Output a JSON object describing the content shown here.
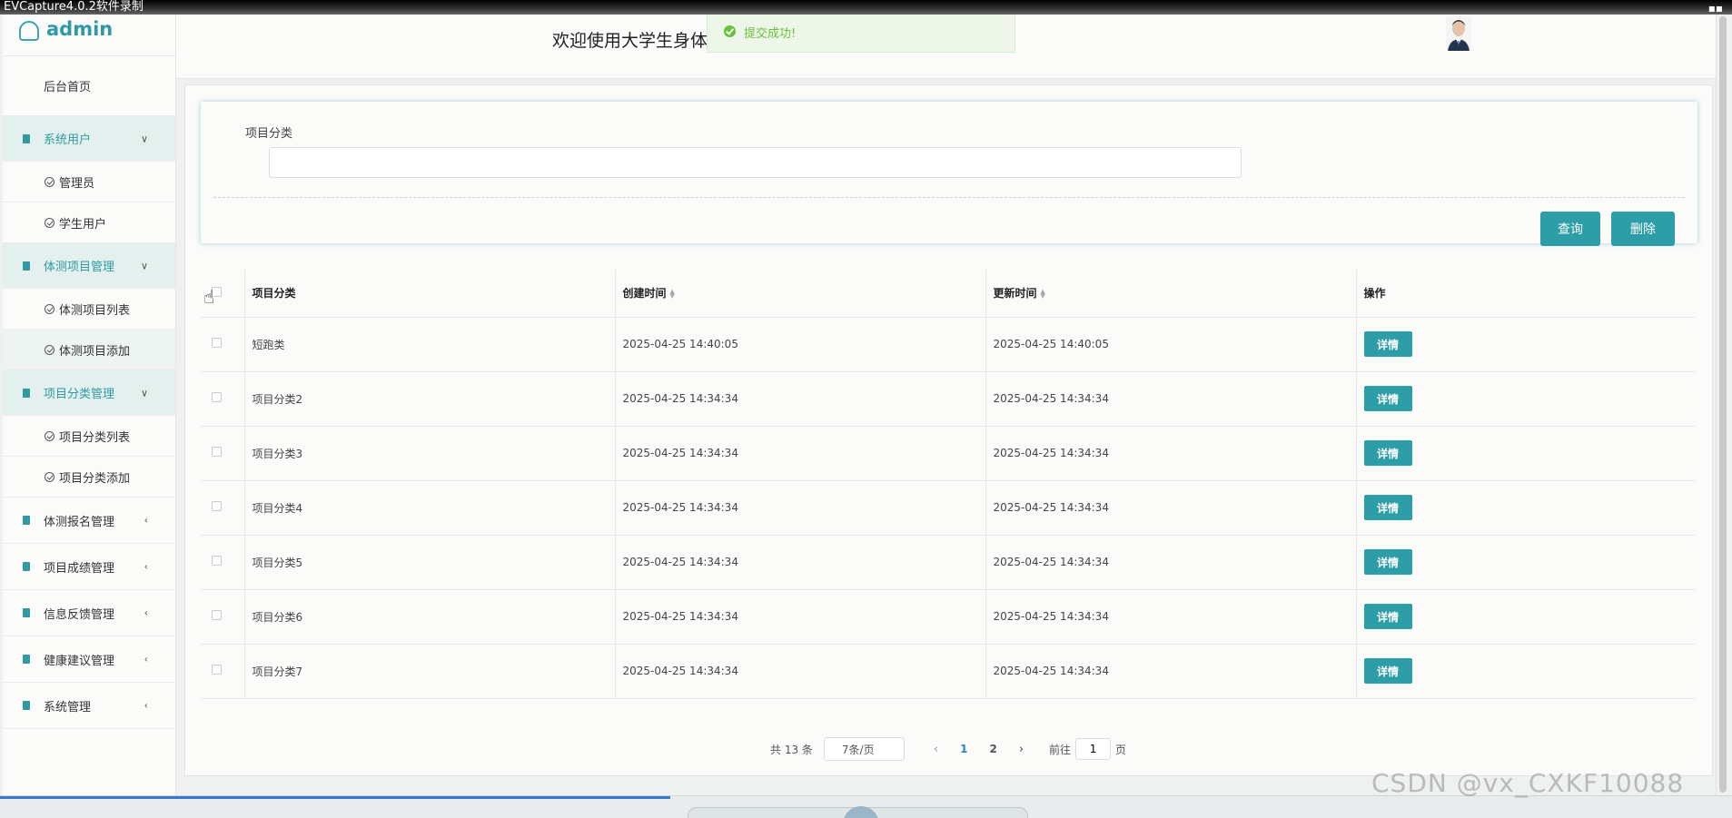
{
  "recorder": {
    "title": "EVCapture4.0.2软件录制",
    "corner_icon": "window-icon"
  },
  "sidebar": {
    "user": "admin",
    "home": "后台首页",
    "groups": [
      {
        "label": "系统用户",
        "items": [
          "管理员",
          "学生用户"
        ]
      },
      {
        "label": "体测项目管理",
        "items": [
          "体测项目列表",
          "体测项目添加"
        ]
      },
      {
        "label": "项目分类管理",
        "items": [
          "项目分类列表",
          "项目分类添加"
        ]
      }
    ],
    "closed": [
      "体测报名管理",
      "项目成绩管理",
      "信息反馈管理",
      "健康建议管理",
      "系统管理"
    ]
  },
  "header": {
    "welcome": "欢迎使用大学生身体",
    "toast": "提交成功!"
  },
  "search": {
    "label": "项目分类",
    "value": "",
    "query_button": "查询",
    "delete_button": "删除"
  },
  "table": {
    "headers": [
      "项目分类",
      "创建时间",
      "更新时间",
      "操作"
    ],
    "rows": [
      {
        "name": "短跑类",
        "created": "2025-04-25 14:40:05",
        "updated": "2025-04-25 14:40:05",
        "action": "详情"
      },
      {
        "name": "项目分类2",
        "created": "2025-04-25 14:34:34",
        "updated": "2025-04-25 14:34:34",
        "action": "详情"
      },
      {
        "name": "项目分类3",
        "created": "2025-04-25 14:34:34",
        "updated": "2025-04-25 14:34:34",
        "action": "详情"
      },
      {
        "name": "项目分类4",
        "created": "2025-04-25 14:34:34",
        "updated": "2025-04-25 14:34:34",
        "action": "详情"
      },
      {
        "name": "项目分类5",
        "created": "2025-04-25 14:34:34",
        "updated": "2025-04-25 14:34:34",
        "action": "详情"
      },
      {
        "name": "项目分类6",
        "created": "2025-04-25 14:34:34",
        "updated": "2025-04-25 14:34:34",
        "action": "详情"
      },
      {
        "name": "项目分类7",
        "created": "2025-04-25 14:34:34",
        "updated": "2025-04-25 14:34:34",
        "action": "详情"
      }
    ]
  },
  "pagination": {
    "total": "共 13 条",
    "page_size": "7条/页",
    "pages": [
      "1",
      "2"
    ],
    "goto_label": "前往",
    "goto_value": "1",
    "page_suffix": "页"
  },
  "watermark": "CSDN @vx_CXKF10088",
  "colors": {
    "accent": "#2d9ea7",
    "success": "#67c23a",
    "active_page": "#2d7fd0"
  }
}
